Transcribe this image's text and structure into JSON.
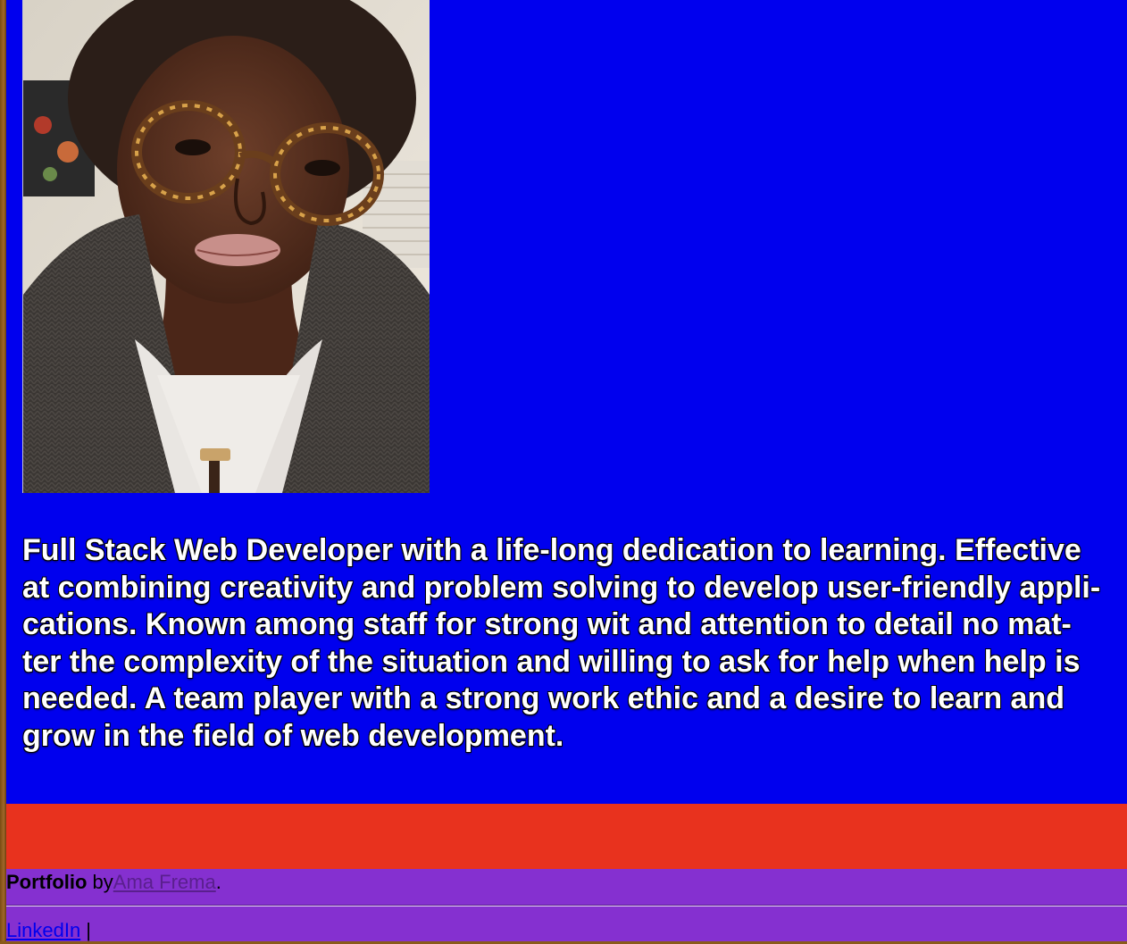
{
  "profile": {
    "bio": "Full Stack Web Developer with a life-long dedication to learning. Effective at combining creativity and problem solving to develop user-friendly appli- cations. Known among staff for strong wit and attention to detail no mat- ter the complexity of the situation and willing to ask for help when help is needed. A team player with a strong work ethic and a desire to learn and grow in the field of web development."
  },
  "footer": {
    "brand": "Portfolio",
    "by_text": " by",
    "author_link": "Ama Frema",
    "period": ".",
    "linkedin_label": "LinkedIn",
    "separator": " |"
  },
  "colors": {
    "hero_bg": "#0000ee",
    "band_red": "#e8321e",
    "footer_purple": "#8530d0",
    "link_blue": "#0000ee"
  }
}
